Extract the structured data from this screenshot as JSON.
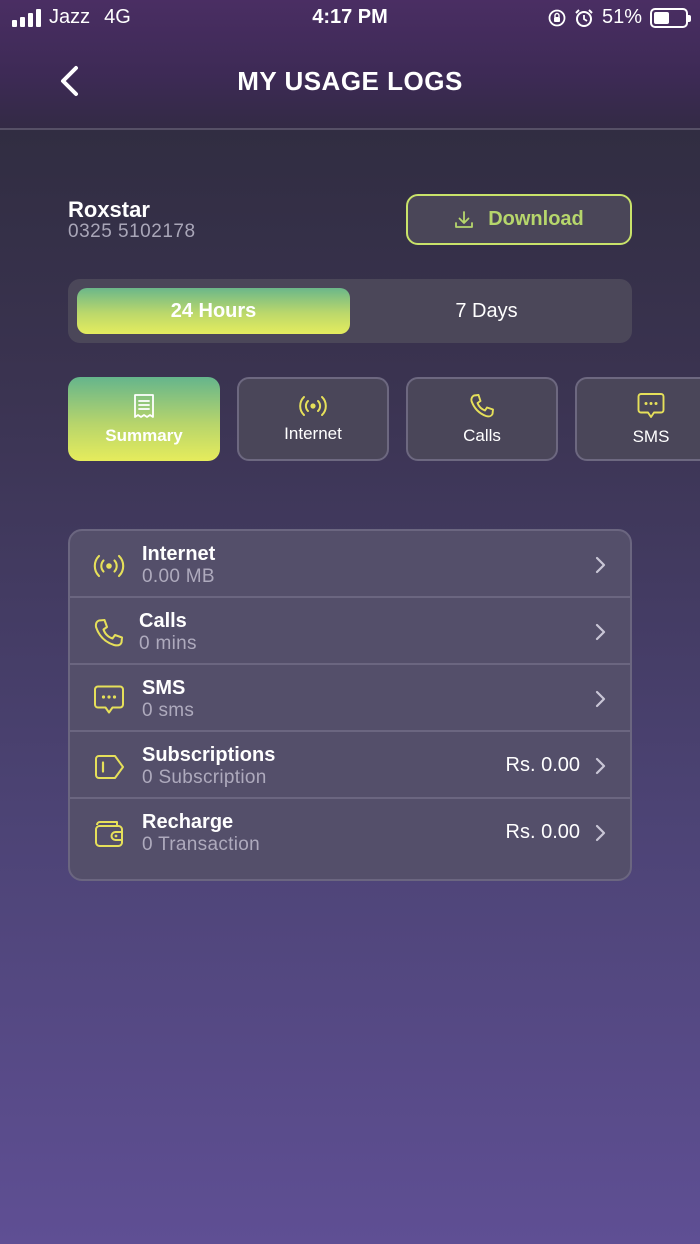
{
  "status_bar": {
    "carrier": "Jazz",
    "network": "4G",
    "time": "4:17 PM",
    "battery": "51%"
  },
  "header": {
    "title": "MY USAGE LOGS",
    "back_icon": "chevron-left-icon"
  },
  "user": {
    "name": "Roxstar",
    "number": "0325 5102178"
  },
  "download": {
    "label": "Download",
    "icon": "download-icon"
  },
  "period_toggle": {
    "options": [
      "24 Hours",
      "7 Days"
    ],
    "selected": "24 Hours"
  },
  "categories": {
    "items": [
      {
        "label": "Summary",
        "icon": "receipt-icon"
      },
      {
        "label": "Internet",
        "icon": "broadcast-icon"
      },
      {
        "label": "Calls",
        "icon": "phone-icon"
      },
      {
        "label": "SMS",
        "icon": "message-icon"
      }
    ],
    "selected": "Summary"
  },
  "usage": {
    "rows": [
      {
        "title": "Internet",
        "subtitle": "0.00 MB",
        "amount": "",
        "icon": "broadcast-icon"
      },
      {
        "title": "Calls",
        "subtitle": "0 mins",
        "amount": "",
        "icon": "phone-icon"
      },
      {
        "title": "SMS",
        "subtitle": "0 sms",
        "amount": "",
        "icon": "message-icon"
      },
      {
        "title": "Subscriptions",
        "subtitle": "0 Subscription",
        "amount": "Rs. 0.00",
        "icon": "tag-icon"
      },
      {
        "title": "Recharge",
        "subtitle": "0 Transaction",
        "amount": "Rs. 0.00",
        "icon": "wallet-icon"
      }
    ]
  },
  "colors": {
    "accent_yellow": "#e6e05a",
    "accent_green": "#6bb78a",
    "download_text": "#b6d66c",
    "card_bg": "#544f6a"
  }
}
